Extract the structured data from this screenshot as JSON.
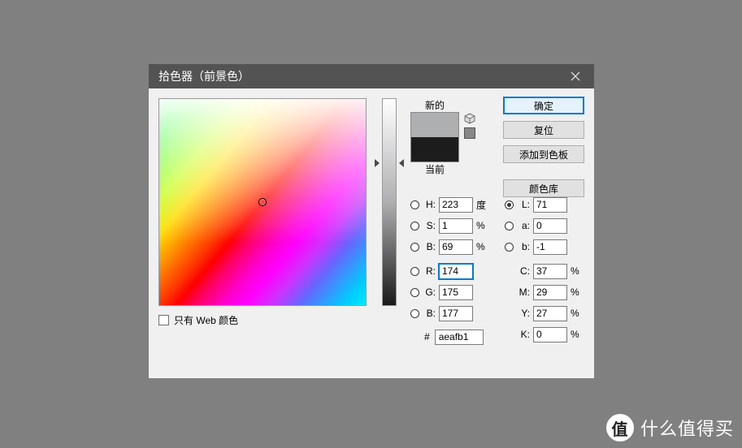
{
  "titlebar": {
    "title": "拾色器（前景色）"
  },
  "swatch": {
    "new_label": "新的",
    "current_label": "当前",
    "new_color": "#aeafb1",
    "current_color": "#1c1c1c"
  },
  "buttons": {
    "ok": "确定",
    "reset": "复位",
    "add_swatch": "添加到色板",
    "library": "颜色库"
  },
  "webonly": {
    "label": "只有 Web 颜色"
  },
  "hsb": {
    "h_label": "H:",
    "h_value": "223",
    "h_unit": "度",
    "s_label": "S:",
    "s_value": "1",
    "s_unit": "%",
    "b_label": "B:",
    "b_value": "69",
    "b_unit": "%"
  },
  "lab": {
    "l_label": "L:",
    "l_value": "71",
    "a_label": "a:",
    "a_value": "0",
    "b_label": "b:",
    "b_value": "-1"
  },
  "rgb": {
    "r_label": "R:",
    "r_value": "174",
    "g_label": "G:",
    "g_value": "175",
    "b_label": "B:",
    "b_value": "177"
  },
  "cmyk": {
    "c_label": "C:",
    "c_value": "37",
    "m_label": "M:",
    "m_value": "29",
    "y_label": "Y:",
    "y_value": "27",
    "k_label": "K:",
    "k_value": "0",
    "unit": "%"
  },
  "hex": {
    "prefix": "#",
    "value": "aeafb1"
  },
  "watermark": {
    "badge": "值",
    "text": "什么值得买"
  }
}
